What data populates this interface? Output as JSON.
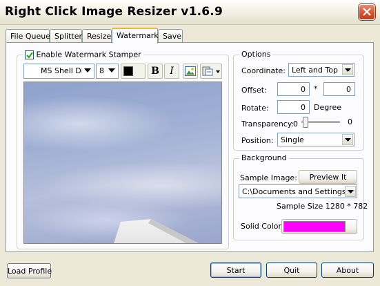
{
  "window": {
    "title": "Right Click Image Resizer v1.6.9"
  },
  "tabs": [
    "File Queue",
    "Splitter",
    "Resize",
    "Watermark",
    "Save"
  ],
  "watermark": {
    "enable_label": "Enable Watermark Stamper",
    "enabled": true,
    "font_name": "MS Shell Dlg",
    "font_size": "8",
    "text_color": "#000000",
    "bold_label": "B",
    "italic_label": "I",
    "image_icon": "picture-icon",
    "paste_icon": "paste-special-icon"
  },
  "options": {
    "legend": "Options",
    "coordinate_label": "Coordinate:",
    "coordinate_value": "Left and Top",
    "offset_label": "Offset:",
    "offset_x": "0",
    "offset_sep": "*",
    "offset_y": "0",
    "rotate_label": "Rotate:",
    "rotate_value": "0",
    "rotate_unit": "Degree",
    "transparency_label": "Transparency:",
    "transparency_min": "0",
    "transparency_max": "0",
    "transparency_level": 0,
    "position_label": "Position:",
    "position_value": "Single"
  },
  "background": {
    "legend": "Background",
    "sample_image_label": "Sample Image:",
    "preview_button": "Preview It",
    "path_value": "C:\\Documents and Settings\\de",
    "sample_size": "Sample Size 1280 * 782",
    "solid_color_label": "Solid Color:",
    "solid_color": "#ff00ff"
  },
  "footer": {
    "load_profile": "Load Profile",
    "start": "Start",
    "quit": "Quit",
    "about": "About"
  }
}
